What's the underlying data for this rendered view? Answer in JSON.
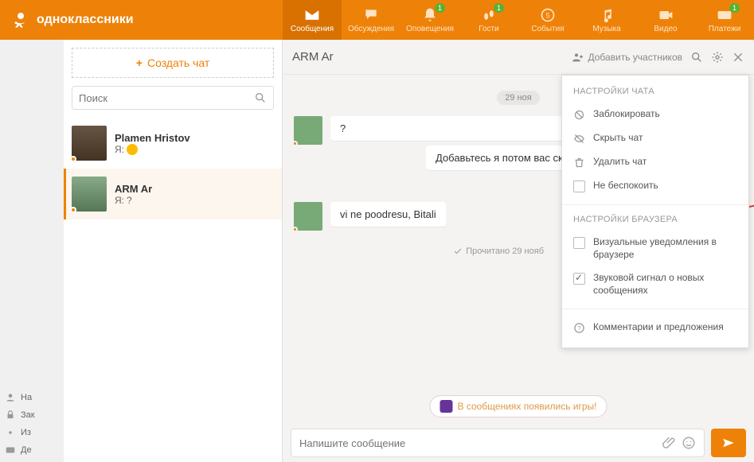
{
  "brand": "одноклассники",
  "nav": {
    "items": [
      {
        "label": "Сообщения",
        "active": true,
        "badge": null,
        "icon": "envelope"
      },
      {
        "label": "Обсуждения",
        "active": false,
        "badge": null,
        "icon": "chat"
      },
      {
        "label": "Оповещения",
        "active": false,
        "badge": "1",
        "icon": "bell"
      },
      {
        "label": "Гости",
        "active": false,
        "badge": "1",
        "icon": "feet"
      },
      {
        "label": "События",
        "active": false,
        "badge": null,
        "icon": "five"
      },
      {
        "label": "Музыка",
        "active": false,
        "badge": null,
        "icon": "music"
      },
      {
        "label": "Видео",
        "active": false,
        "badge": null,
        "icon": "video"
      },
      {
        "label": "Платежи",
        "active": false,
        "badge": "1",
        "icon": "card"
      }
    ]
  },
  "left_menu": {
    "items": [
      {
        "label": "На"
      },
      {
        "label": "Зак"
      },
      {
        "label": "Из"
      },
      {
        "label": "Де"
      }
    ]
  },
  "chatlist": {
    "create_label": "Создать чат",
    "search_placeholder": "Поиск",
    "items": [
      {
        "name": "Plamen Hristov",
        "last_prefix": "Я:",
        "last": "",
        "emoji": true,
        "active": false
      },
      {
        "name": "ARM Ar",
        "last_prefix": "Я:",
        "last": "?",
        "emoji": false,
        "active": true
      }
    ]
  },
  "chat": {
    "title": "ARM Ar",
    "add_participants": "Добавить участников",
    "date": "29 ноя",
    "messages": [
      {
        "text": "?"
      },
      {
        "text": "Добавьтесь я потом вас скриншотов для инструк"
      },
      {
        "text": "vi ne poodresu, Bitali"
      }
    ],
    "read_status": "Прочитано 29 нояб",
    "games_banner": "В сообщениях появились игры!",
    "compose_placeholder": "Напишите сообщение"
  },
  "settings": {
    "chat_title": "НАСТРОЙКИ ЧАТА",
    "block": "Заблокировать",
    "hide": "Скрыть чат",
    "delete": "Удалить чат",
    "dnd": "Не беспокоить",
    "browser_title": "НАСТРОЙКИ БРАУЗЕРА",
    "visual": "Визуальные уведомления в браузере",
    "sound": "Звуковой сигнал о новых сообщениях",
    "feedback": "Комментарии и предложения"
  }
}
